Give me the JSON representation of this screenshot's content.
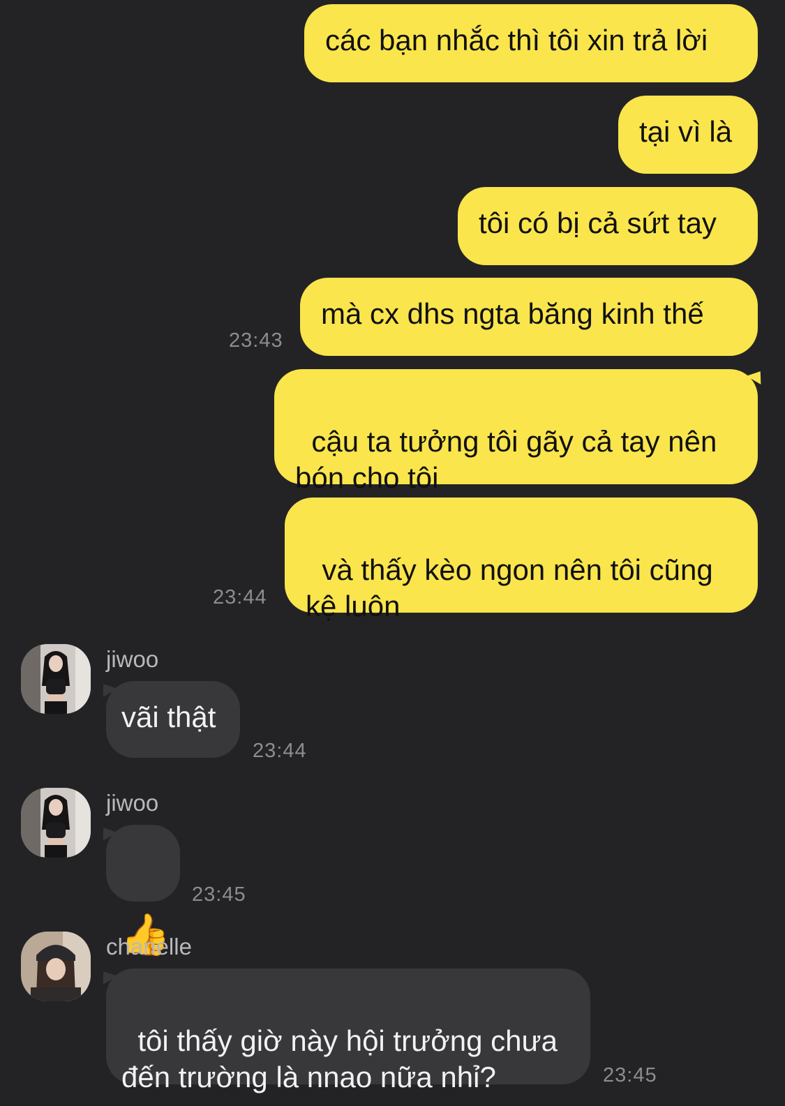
{
  "conversation": {
    "outgoing": [
      {
        "text": "các bạn nhắc thì tôi xin trả lời"
      },
      {
        "text": "tại vì là"
      },
      {
        "text": "tôi có bị cả sứt tay"
      },
      {
        "text": "mà cx dhs ngta băng kinh thế",
        "time": "23:43"
      },
      {
        "text": "cậu ta tưởng tôi gãy cả tay nên bón cho tôi"
      },
      {
        "text": "và thấy kèo ngon nên tôi cũng kệ luôn",
        "time": "23:44"
      }
    ],
    "incoming": [
      {
        "sender": "jiwoo",
        "text": "vãi thật",
        "time": "23:44",
        "avatar": "girl-portrait-avatar"
      },
      {
        "sender": "jiwoo",
        "text": "👍",
        "time": "23:45",
        "avatar": "girl-portrait-avatar"
      },
      {
        "sender": "chanelle",
        "text": "tôi thấy giờ này hội trưởng chưa đến trường là nnao nữa nhỉ?",
        "time": "23:45",
        "avatar": "girl-beanie-avatar"
      }
    ]
  },
  "colors": {
    "background": "#232326",
    "outgoing_bubble": "#fae54c",
    "incoming_bubble": "#38383b",
    "timestamp": "#8d8d91"
  }
}
